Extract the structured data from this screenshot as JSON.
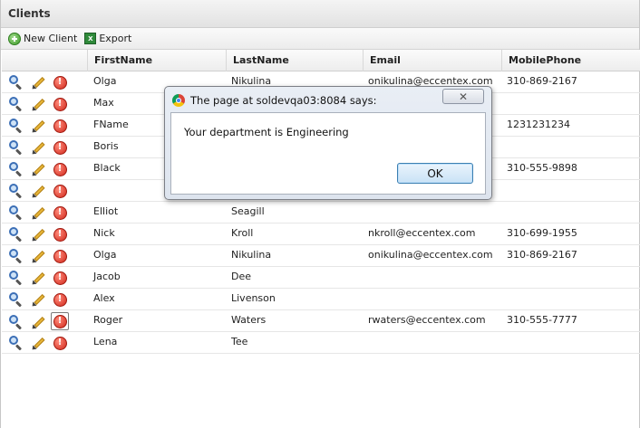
{
  "panel": {
    "title": "Clients"
  },
  "toolbar": {
    "new_client_label": "New Client",
    "new_client_icon": "add-icon",
    "export_label": "Export",
    "export_icon": "excel-icon",
    "export_icon_glyph": "X"
  },
  "grid": {
    "columns": [
      "",
      "FirstName",
      "LastName",
      "Email",
      "MobilePhone"
    ],
    "row_action_icons": [
      "magnifier-icon",
      "pencil-icon",
      "warning-icon"
    ],
    "warning_glyph": "!",
    "rows": [
      {
        "first": "Olga",
        "last": "Nikulina",
        "email": "onikulina@eccentex.com",
        "phone": "310-869-2167"
      },
      {
        "first": "Max",
        "last": "",
        "email": "",
        "phone": ""
      },
      {
        "first": "FName",
        "last": "",
        "email": "",
        "phone": "1231231234"
      },
      {
        "first": "Boris",
        "last": "",
        "email": "",
        "phone": ""
      },
      {
        "first": "Black",
        "last": "",
        "email": "",
        "phone": "310-555-9898"
      },
      {
        "first": "",
        "last": "",
        "email": "",
        "phone": ""
      },
      {
        "first": "Elliot",
        "last": "Seagill",
        "email": "",
        "phone": ""
      },
      {
        "first": "Nick",
        "last": "Kroll",
        "email": "nkroll@eccentex.com",
        "phone": "310-699-1955"
      },
      {
        "first": "Olga",
        "last": "Nikulina",
        "email": "onikulina@eccentex.com",
        "phone": "310-869-2167"
      },
      {
        "first": "Jacob",
        "last": "Dee",
        "email": "",
        "phone": ""
      },
      {
        "first": "Alex",
        "last": "Livenson",
        "email": "",
        "phone": ""
      },
      {
        "first": "Roger",
        "last": "Waters",
        "email": "rwaters@eccentex.com",
        "phone": "310-555-7777"
      },
      {
        "first": "Lena",
        "last": "Tee",
        "email": "",
        "phone": ""
      }
    ]
  },
  "dialog": {
    "title": "The page at soldevqa03:8084 says:",
    "message": "Your department is Engineering",
    "ok_label": "OK",
    "close_glyph": "✕",
    "icon": "chrome-icon"
  }
}
